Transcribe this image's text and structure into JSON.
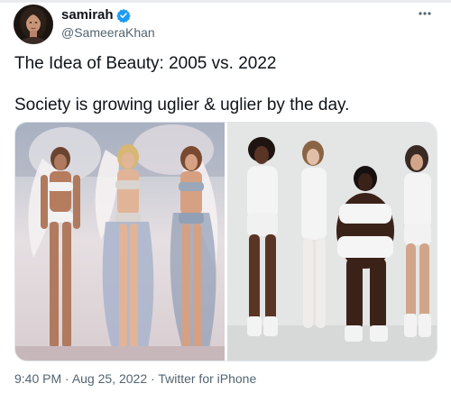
{
  "tweet": {
    "author": {
      "display_name": "samirah",
      "handle": "@SameeraKhan",
      "verified": true
    },
    "text_lines": [
      "The Idea of Beauty: 2005 vs. 2022",
      "Society is growing uglier & uglier by the day."
    ],
    "meta": {
      "time": "9:40 PM",
      "separator": " · ",
      "date": "Aug 25, 2022",
      "source": "Twitter for iPhone"
    }
  },
  "colors": {
    "verified_badge": "#1d9bf0",
    "secondary_text": "#536471",
    "primary_text": "#0f1419"
  },
  "icons": {
    "verified": "verified-badge-icon",
    "more": "more-dots-icon"
  }
}
